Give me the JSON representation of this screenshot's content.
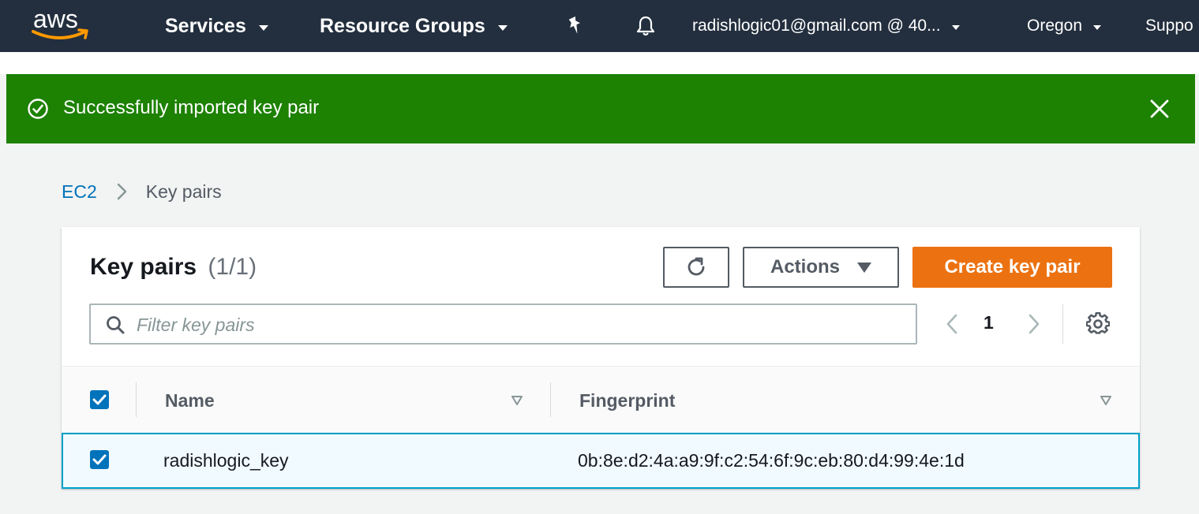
{
  "topnav": {
    "logo_text": "aws",
    "services": "Services",
    "resource_groups": "Resource Groups",
    "account": "radishlogic01@gmail.com @ 40...",
    "region": "Oregon",
    "support": "Suppo",
    "icons": [
      "pin-icon",
      "bell-icon"
    ]
  },
  "flash": {
    "message": "Successfully imported key pair",
    "type": "success",
    "color": "#1d8102"
  },
  "breadcrumb": {
    "root": "EC2",
    "current": "Key pairs"
  },
  "panel": {
    "title": "Key pairs",
    "count": "(1/1)",
    "actions_label": "Actions",
    "create_label": "Create key pair",
    "filter_placeholder": "Filter key pairs",
    "page_number": "1"
  },
  "table": {
    "columns": [
      "Name",
      "Fingerprint"
    ],
    "rows": [
      {
        "selected": true,
        "name": "radishlogic_key",
        "fingerprint": "0b:8e:d2:4a:a9:9f:c2:54:6f:9c:eb:80:d4:99:4e:1d"
      }
    ]
  },
  "colors": {
    "nav_bg": "#232f3e",
    "primary_button": "#ec7211",
    "link": "#0073bb",
    "checkbox": "#0073bb",
    "selected_row_border": "#00a1c9"
  }
}
